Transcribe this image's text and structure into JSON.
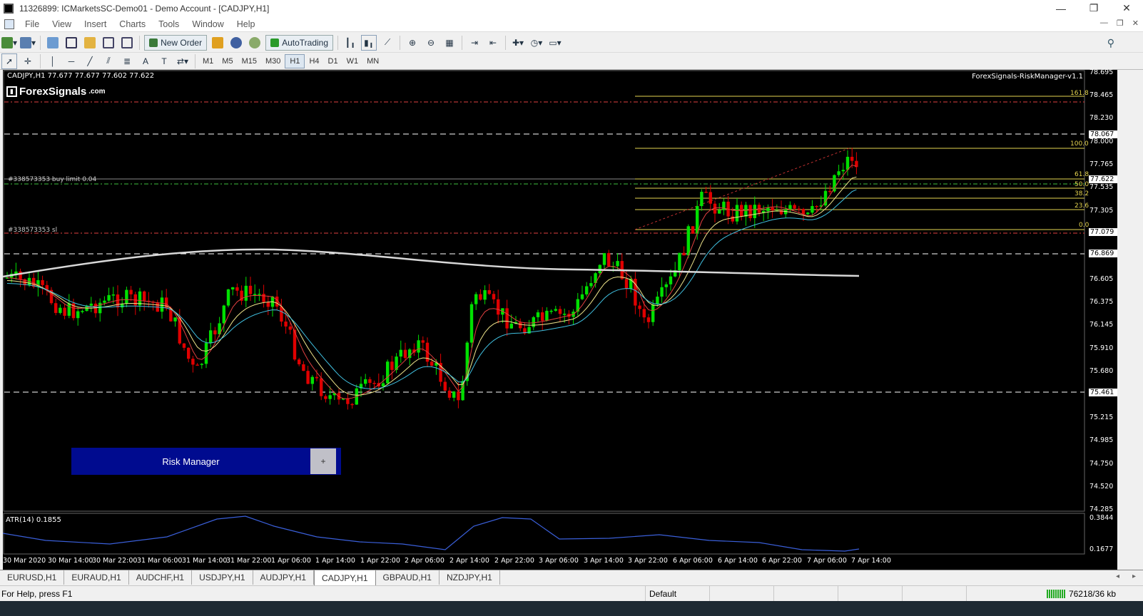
{
  "window": {
    "title": "11326899: ICMarketsSC-Demo01 - Demo Account - [CADJPY,H1]",
    "minimize": "—",
    "restore": "❐",
    "close": "✕"
  },
  "menu": {
    "items": [
      "File",
      "View",
      "Insert",
      "Charts",
      "Tools",
      "Window",
      "Help"
    ]
  },
  "toolbar": {
    "new_order_label": "New Order",
    "autotrading_label": "AutoTrading",
    "timeframes": [
      "M1",
      "M5",
      "M15",
      "M30",
      "H1",
      "H4",
      "D1",
      "W1",
      "MN"
    ],
    "active_timeframe": "H1"
  },
  "chart": {
    "info_line": "CADJPY,H1  77.677 77.677 77.602 77.622",
    "brand_name": "ForexSignals",
    "brand_suffix": ".com",
    "ea_name": "ForexSignals-RiskManager-v1.1",
    "indicator_label": "ATR(14) 0.1855",
    "orders": {
      "buy_limit": "#338573353 buy limit 0.04",
      "stop_loss": "#338573353 sl"
    },
    "fib_levels": [
      "161.8",
      "100.0",
      "61.8",
      "50.0",
      "38.2",
      "23.6",
      "0.0"
    ],
    "price_axis": [
      "78.695",
      "78.465",
      "78.230",
      "78.000",
      "77.765",
      "77.535",
      "77.305",
      "76.605",
      "76.375",
      "76.145",
      "75.910",
      "75.680",
      "75.215",
      "74.985",
      "74.750",
      "74.520",
      "74.285"
    ],
    "price_tags": [
      "78.067",
      "77.622",
      "77.079",
      "76.869",
      "75.461"
    ],
    "indicator_axis": [
      "0.3844",
      "0.1677"
    ],
    "time_axis": [
      "30 Mar 2020",
      "30 Mar 14:00",
      "30 Mar 22:00",
      "31 Mar 06:00",
      "31 Mar 14:00",
      "31 Mar 22:00",
      "1 Apr 06:00",
      "1 Apr 14:00",
      "1 Apr 22:00",
      "2 Apr 06:00",
      "2 Apr 14:00",
      "2 Apr 22:00",
      "3 Apr 06:00",
      "3 Apr 14:00",
      "3 Apr 22:00",
      "6 Apr 06:00",
      "6 Apr 14:00",
      "6 Apr 22:00",
      "7 Apr 06:00",
      "7 Apr 14:00"
    ],
    "colors": {
      "background": "#000000",
      "bull": "#00e000",
      "bear": "#e00000",
      "fib": "#e5d44f",
      "ma200": "#d8d8d8",
      "atr": "#3a5fd9"
    }
  },
  "risk_manager": {
    "title": "Risk Manager",
    "expand": "+"
  },
  "tabs": {
    "items": [
      "EURUSD,H1",
      "EURAUD,H1",
      "AUDCHF,H1",
      "USDJPY,H1",
      "AUDJPY,H1",
      "CADJPY,H1",
      "GBPAUD,H1",
      "NZDJPY,H1"
    ],
    "active": "CADJPY,H1"
  },
  "status": {
    "help": "For Help, press F1",
    "profile": "Default",
    "traffic": "76218/36 kb"
  }
}
